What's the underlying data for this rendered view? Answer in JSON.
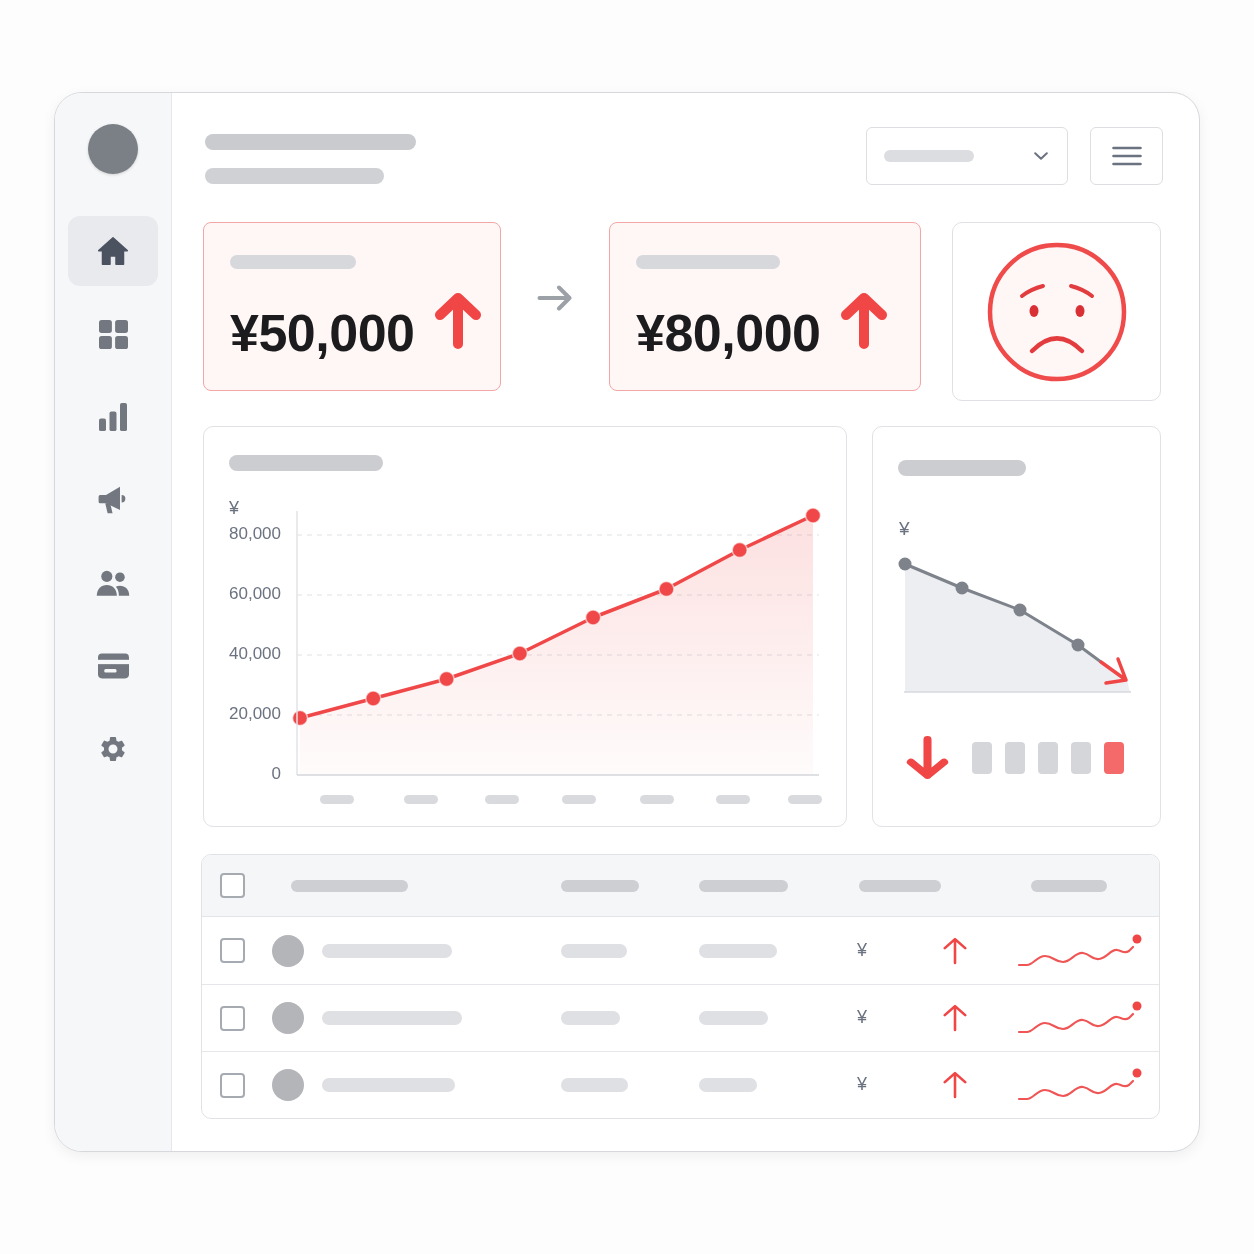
{
  "sidebar": {
    "items": [
      {
        "selected": true
      },
      {
        "selected": false
      },
      {
        "selected": false
      },
      {
        "selected": false
      },
      {
        "selected": false
      },
      {
        "selected": false
      },
      {
        "selected": false
      }
    ]
  },
  "kpis": [
    {
      "value": "¥50,000",
      "rising": true
    },
    {
      "value": "¥80,000",
      "rising": true
    }
  ],
  "revenue_chart": {
    "chart_data": {
      "type": "area",
      "ylabel": "¥",
      "ylim": [
        0,
        88000
      ],
      "grid": true,
      "yticks": [
        0,
        {
          "value": 20000,
          "label": "20,000"
        },
        {
          "value": 40000,
          "label": "40,000"
        },
        {
          "value": 60000,
          "label": "60,000"
        },
        {
          "value": 80000,
          "label": "80,000"
        }
      ],
      "series": [
        {
          "color": "#f04848",
          "values": [
            19000,
            25500,
            32000,
            40500,
            52500,
            62000,
            75000,
            86500
          ]
        }
      ]
    }
  },
  "trend_panel": {
    "currency": "¥",
    "rising": false,
    "segments": [
      {
        "color": "#d5d6d9"
      },
      {
        "color": "#d5d6d9"
      },
      {
        "color": "#d5d6d9"
      },
      {
        "color": "#d5d6d9"
      },
      {
        "color": "#f46a6a"
      }
    ]
  },
  "table": {
    "header": {
      "checked": false
    },
    "rows": [
      {
        "checked": false,
        "currency": "¥",
        "rising": true
      },
      {
        "checked": false,
        "currency": "¥",
        "rising": true
      },
      {
        "checked": false,
        "currency": "¥",
        "rising": true
      }
    ]
  }
}
